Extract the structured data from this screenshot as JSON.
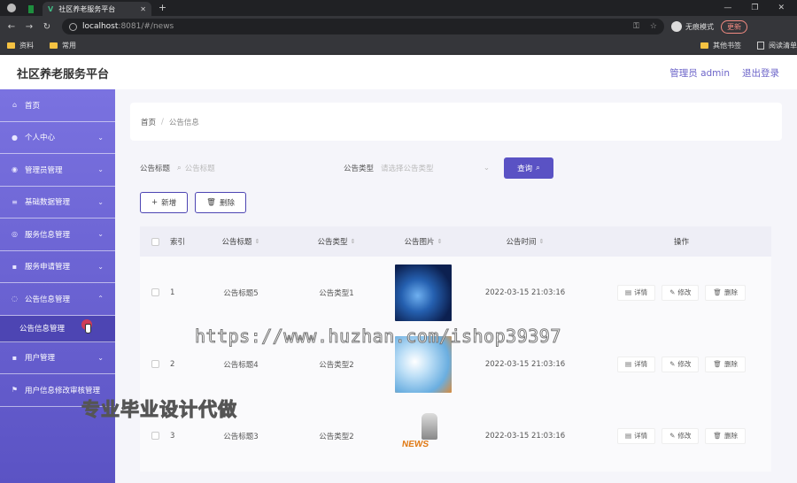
{
  "browser": {
    "tab_active_title": "社区养老服务平台",
    "url_host": "localhost",
    "url_path": ":8081/#/news",
    "incognito_label": "无痕模式",
    "update_label": "更新",
    "bookmarks": [
      "资料",
      "常用"
    ],
    "bookmarks_right": [
      "其他书签",
      "阅读清单"
    ]
  },
  "app": {
    "title": "社区养老服务平台",
    "user_label": "管理员 admin",
    "logout_label": "退出登录"
  },
  "sidebar": {
    "items": [
      {
        "label": "首页",
        "icon": "home-icon"
      },
      {
        "label": "个人中心",
        "icon": "user-icon"
      },
      {
        "label": "管理员管理",
        "icon": "admin-icon"
      },
      {
        "label": "基础数据管理",
        "icon": "list-icon"
      },
      {
        "label": "服务信息管理",
        "icon": "service-icon"
      },
      {
        "label": "服务申请管理",
        "icon": "apply-icon"
      },
      {
        "label": "公告信息管理",
        "icon": "notice-icon"
      },
      {
        "label": "用户管理",
        "icon": "users-icon"
      },
      {
        "label": "用户信息修改审核管理",
        "icon": "flag-icon"
      }
    ],
    "sub_item": "公告信息管理"
  },
  "breadcrumb": {
    "home": "首页",
    "separator": "/",
    "current": "公告信息"
  },
  "search": {
    "title_label": "公告标题",
    "title_placeholder": "公告标题",
    "type_label": "公告类型",
    "type_placeholder": "请选择公告类型",
    "query_label": "查询"
  },
  "actions": {
    "add_label": "新增",
    "delete_label": "删除"
  },
  "table": {
    "headers": [
      "索引",
      "公告标题",
      "公告类型",
      "公告图片",
      "公告时间",
      "操作"
    ],
    "rows": [
      {
        "index": "1",
        "title": "公告标题5",
        "type": "公告类型1",
        "time": "2022-03-15 21:03:16"
      },
      {
        "index": "2",
        "title": "公告标题4",
        "type": "公告类型2",
        "time": "2022-03-15 21:03:16"
      },
      {
        "index": "3",
        "title": "公告标题3",
        "type": "公告类型2",
        "time": "2022-03-15 21:03:16"
      }
    ],
    "ops": {
      "detail": "详情",
      "edit": "修改",
      "delete": "删除"
    },
    "image_text": "NEWS"
  },
  "watermarks": {
    "url": "https://www.huzhan.com/ishop39397",
    "slogan": "专业毕业设计代做"
  }
}
